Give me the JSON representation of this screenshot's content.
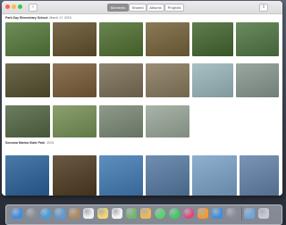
{
  "toolbar": {
    "tabs": [
      {
        "label": "Moments",
        "active": true
      },
      {
        "label": "Shared",
        "active": false
      },
      {
        "label": "Albums",
        "active": false
      },
      {
        "label": "Projects",
        "active": false
      }
    ],
    "back_icon": "chevron-left-icon",
    "share_icon": "share-icon"
  },
  "moments": [
    {
      "title": "Park Day Elementary School",
      "date": "March 17, 2015"
    },
    {
      "title": "Sonoma Marina State Park",
      "date": "2015"
    }
  ],
  "photo_colors": {
    "row1": [
      "#6f8d58",
      "#7a6b4c",
      "#6a8550",
      "#8a7a58",
      "#5f7d4f",
      "#6b8a60"
    ],
    "row2": [
      "#6d6a4e",
      "#8e7456",
      "#8f8470",
      "#9a8d76",
      "#a9c0c4",
      "#9aa6a0"
    ],
    "row3": [
      "#6c7d60",
      "#8aa06e",
      "#8e9a8a",
      "#a8b4a8"
    ],
    "row4": [
      "#4b7aa8",
      "#6a5a44",
      "#5e8fbf",
      "#708fb0",
      "#8fb0cf",
      "#7a95b5"
    ]
  },
  "dock": {
    "icons": [
      "finder-icon",
      "launchpad-icon",
      "safari-icon",
      "mail-icon",
      "contacts-icon",
      "calendar-icon",
      "notes-icon",
      "reminders-icon",
      "maps-icon",
      "photos-icon",
      "messages-icon",
      "facetime-icon",
      "itunes-icon",
      "ibooks-icon",
      "app-store-icon",
      "system-preferences-icon",
      "downloads-icon",
      "trash-icon"
    ]
  }
}
